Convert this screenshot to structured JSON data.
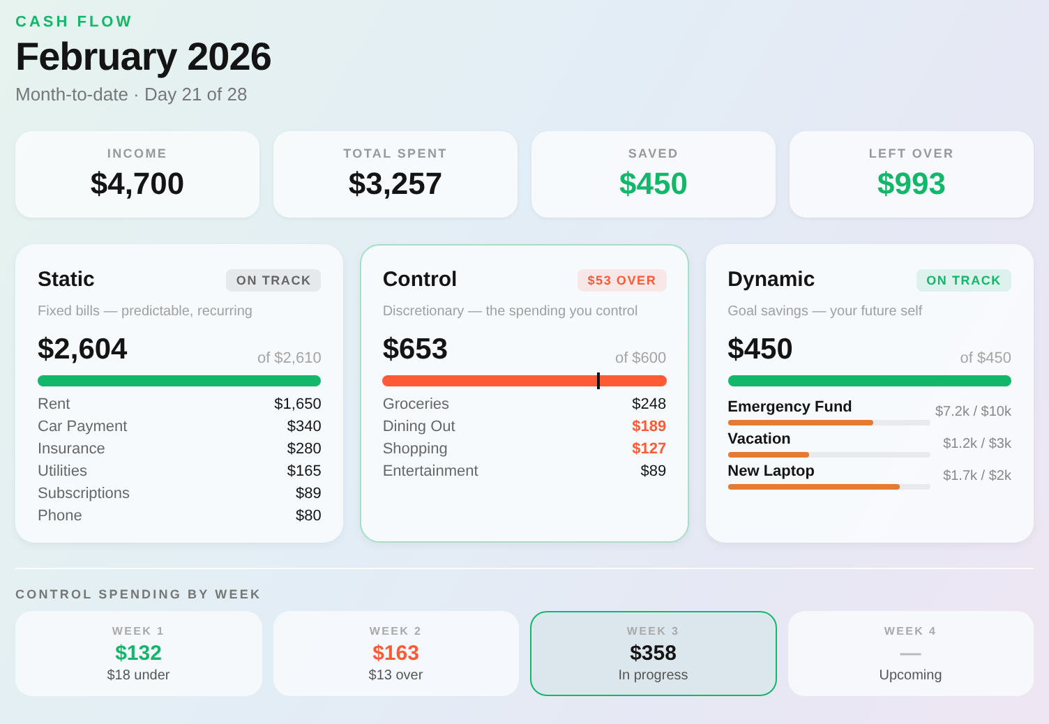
{
  "header": {
    "eyebrow": "CASH FLOW",
    "title": "February 2026",
    "subtitle": "Month-to-date · Day 21 of 28"
  },
  "summary": [
    {
      "label": "INCOME",
      "value": "$4,700",
      "color": "#141414"
    },
    {
      "label": "TOTAL SPENT",
      "value": "$3,257",
      "color": "#141414"
    },
    {
      "label": "SAVED",
      "value": "$450",
      "color": "#12b76a"
    },
    {
      "label": "LEFT OVER",
      "value": "$993",
      "color": "#12b76a"
    }
  ],
  "categories": [
    {
      "kind": "lines",
      "name": "Static",
      "badge": {
        "text": "ON TRACK",
        "color": "#666666"
      },
      "description": "Fixed bills — predictable, recurring",
      "amount": "$2,604",
      "budget": "of $2,610",
      "bar": {
        "color": "#12b76a",
        "level": 0.998
      },
      "selected": false,
      "items": [
        {
          "label": "Rent",
          "value": "$1,650",
          "over": false
        },
        {
          "label": "Car Payment",
          "value": "$340",
          "over": false
        },
        {
          "label": "Insurance",
          "value": "$280",
          "over": false
        },
        {
          "label": "Utilities",
          "value": "$165",
          "over": false
        },
        {
          "label": "Subscriptions",
          "value": "$89",
          "over": false
        },
        {
          "label": "Phone",
          "value": "$80",
          "over": false
        }
      ]
    },
    {
      "kind": "lines",
      "name": "Control",
      "badge": {
        "text": "$53 OVER",
        "color": "#ff5a36"
      },
      "description": "Discretionary — the spending you control",
      "amount": "$653",
      "budget": "of $600",
      "bar": {
        "color": "#ff5a36",
        "level": 1
      },
      "budget_marker": {
        "level": 0.755
      },
      "selected": true,
      "items": [
        {
          "label": "Groceries",
          "value": "$248",
          "over": false
        },
        {
          "label": "Dining Out",
          "value": "$189",
          "over": true
        },
        {
          "label": "Shopping",
          "value": "$127",
          "over": true
        },
        {
          "label": "Entertainment",
          "value": "$89",
          "over": false
        }
      ]
    },
    {
      "kind": "goals",
      "name": "Dynamic",
      "badge": {
        "text": "ON TRACK",
        "color": "#12b76a"
      },
      "description": "Goal savings — your future self",
      "amount": "$450",
      "budget": "of $450",
      "bar": {
        "color": "#12b76a",
        "level": 1
      },
      "selected": false,
      "items": [
        {
          "label": "Emergency Fund",
          "value": "$7.2k / $10k",
          "level": 0.72
        },
        {
          "label": "Vacation",
          "value": "$1.2k / $3k",
          "level": 0.4
        },
        {
          "label": "New Laptop",
          "value": "$1.7k / $2k",
          "level": 0.85
        }
      ]
    }
  ],
  "weekly": {
    "title": "CONTROL SPENDING BY WEEK",
    "weeks": [
      {
        "label": "WEEK 1",
        "value": "$132",
        "note": "$18 under",
        "color": "#12b76a",
        "selected": false
      },
      {
        "label": "WEEK 2",
        "value": "$163",
        "note": "$13 over",
        "color": "#ff5a36",
        "selected": false
      },
      {
        "label": "WEEK 3",
        "value": "$358",
        "note": "In progress",
        "color": "#141414",
        "selected": true
      },
      {
        "label": "WEEK 4",
        "value": "—",
        "note": "Upcoming",
        "color": "#bbbbbb",
        "selected": false
      }
    ]
  }
}
